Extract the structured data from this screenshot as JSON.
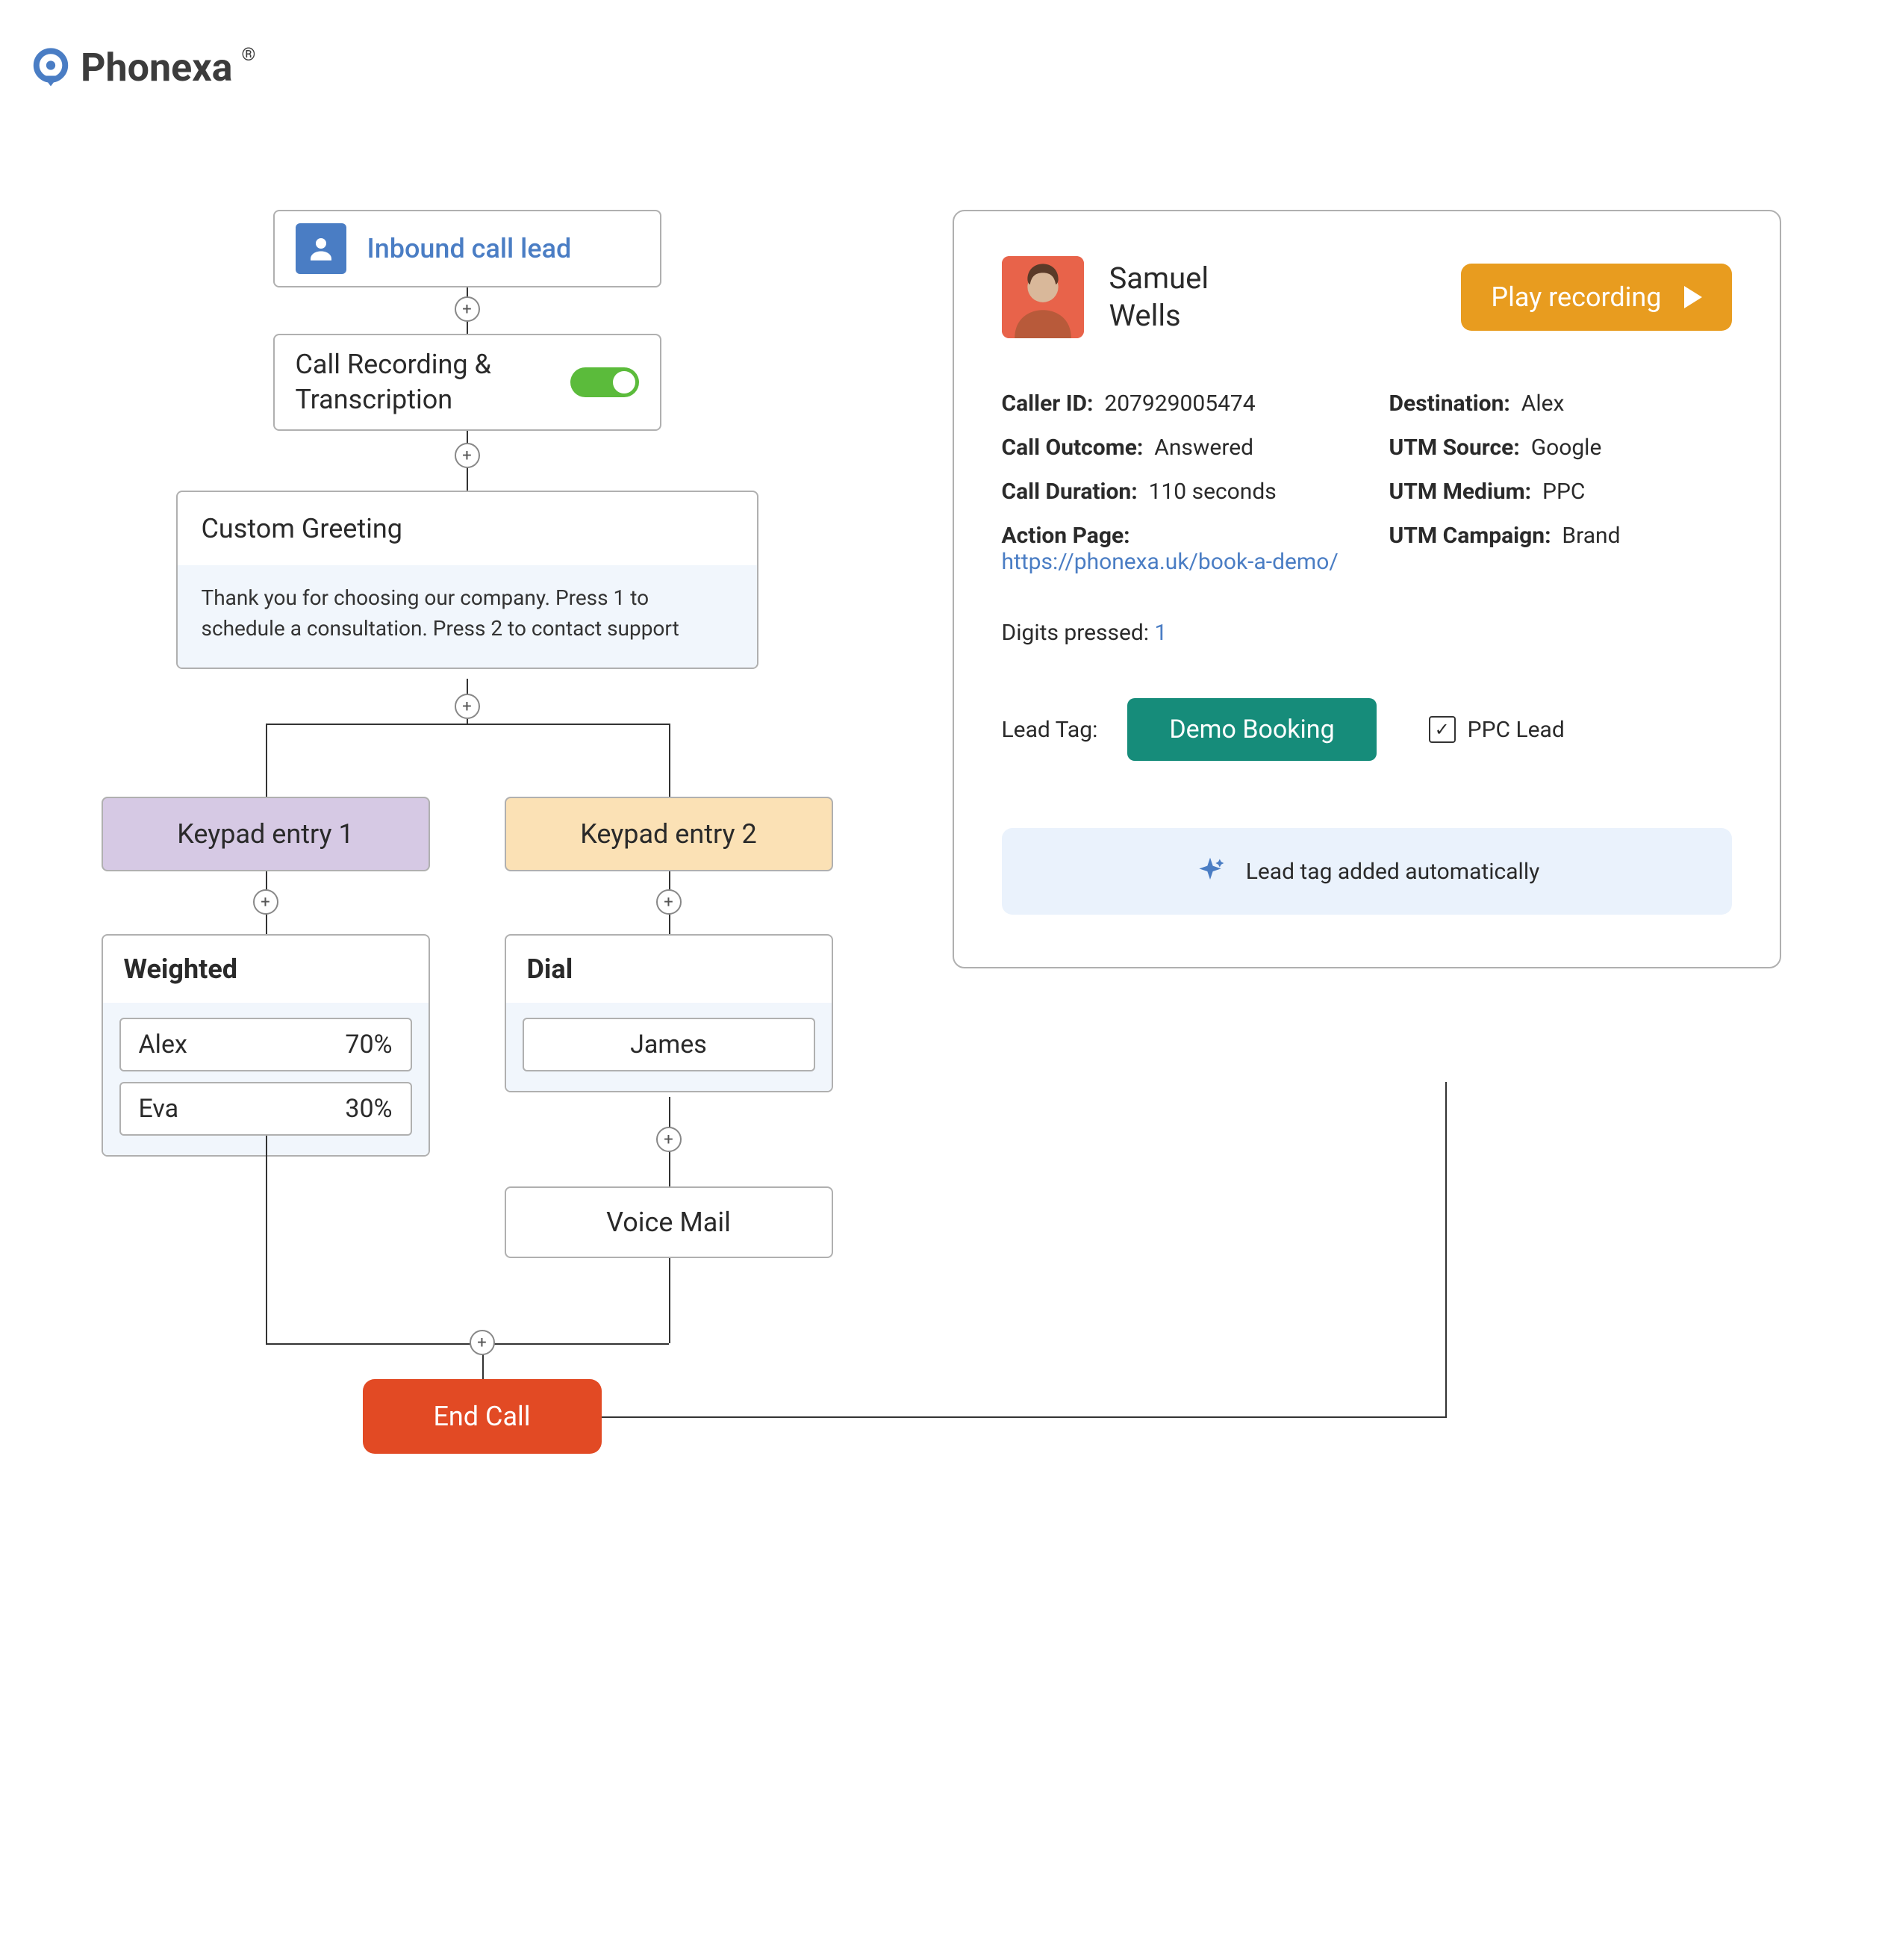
{
  "logo": {
    "name": "Phonexa",
    "reg": "®"
  },
  "flow": {
    "inbound": "Inbound call lead",
    "recording": "Call Recording & Transcription",
    "recording_on": true,
    "greeting": {
      "title": "Custom Greeting",
      "body": "Thank you for choosing our company. Press 1 to schedule a consultation. Press 2 to contact support"
    },
    "keypad1": "Keypad entry 1",
    "keypad2": "Keypad entry 2",
    "weighted": {
      "title": "Weighted",
      "rows": [
        {
          "name": "Alex",
          "pct": "70%"
        },
        {
          "name": "Eva",
          "pct": "30%"
        }
      ]
    },
    "dial": {
      "title": "Dial",
      "name": "James"
    },
    "vmail": "Voice Mail",
    "endcall": "End Call"
  },
  "panel": {
    "name_first": "Samuel",
    "name_last": "Wells",
    "play": "Play recording",
    "details": {
      "caller_id_label": "Caller ID:",
      "caller_id": "207929005474",
      "outcome_label": "Call Outcome:",
      "outcome": "Answered",
      "duration_label": "Call Duration:",
      "duration": "110 seconds",
      "action_label": "Action Page:",
      "action_url": "https://phonexa.uk/book-a-demo/",
      "destination_label": "Destination:",
      "destination": "Alex",
      "utm_source_label": "UTM Source:",
      "utm_source": "Google",
      "utm_medium_label": "UTM Medium:",
      "utm_medium": "PPC",
      "utm_campaign_label": "UTM Campaign:",
      "utm_campaign": "Brand"
    },
    "digits_label": "Digits pressed:",
    "digits": "1",
    "lead_tag_label": "Lead Tag:",
    "lead_tag": "Demo Booking",
    "ppc_lead": "PPC Lead",
    "ppc_checked": true,
    "auto": "Lead tag added automatically"
  }
}
